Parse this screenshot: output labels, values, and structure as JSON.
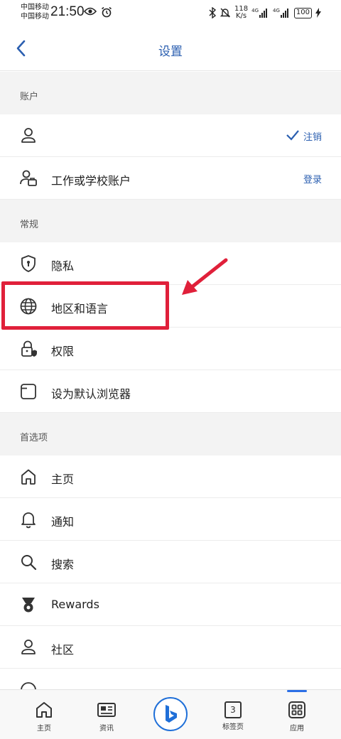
{
  "status_bar": {
    "carrier1": "中国移动",
    "carrier2": "中国移动",
    "time": "21:50",
    "net_speed_value": "118",
    "net_speed_unit": "K/s",
    "signal1": "4G",
    "signal2": "4G",
    "battery": "100"
  },
  "header": {
    "title": "设置"
  },
  "sections": {
    "account": "账户",
    "general": "常规",
    "preferences": "首选项"
  },
  "account_rows": {
    "profile_action": "注销",
    "work_label": "工作或学校账户",
    "work_action": "登录"
  },
  "general_rows": {
    "privacy": "隐私",
    "region_language": "地区和语言",
    "permissions": "权限",
    "default_browser": "设为默认浏览器"
  },
  "preference_rows": {
    "home": "主页",
    "notifications": "通知",
    "search": "搜索",
    "rewards": "Rewards",
    "community": "社区",
    "partial": "…"
  },
  "bottom_nav": {
    "home": "主页",
    "news": "资讯",
    "tabs": "标签页",
    "tabs_count": "3",
    "apps": "应用"
  },
  "colors": {
    "accent": "#2b5fb0",
    "annotation": "#e0203a"
  }
}
